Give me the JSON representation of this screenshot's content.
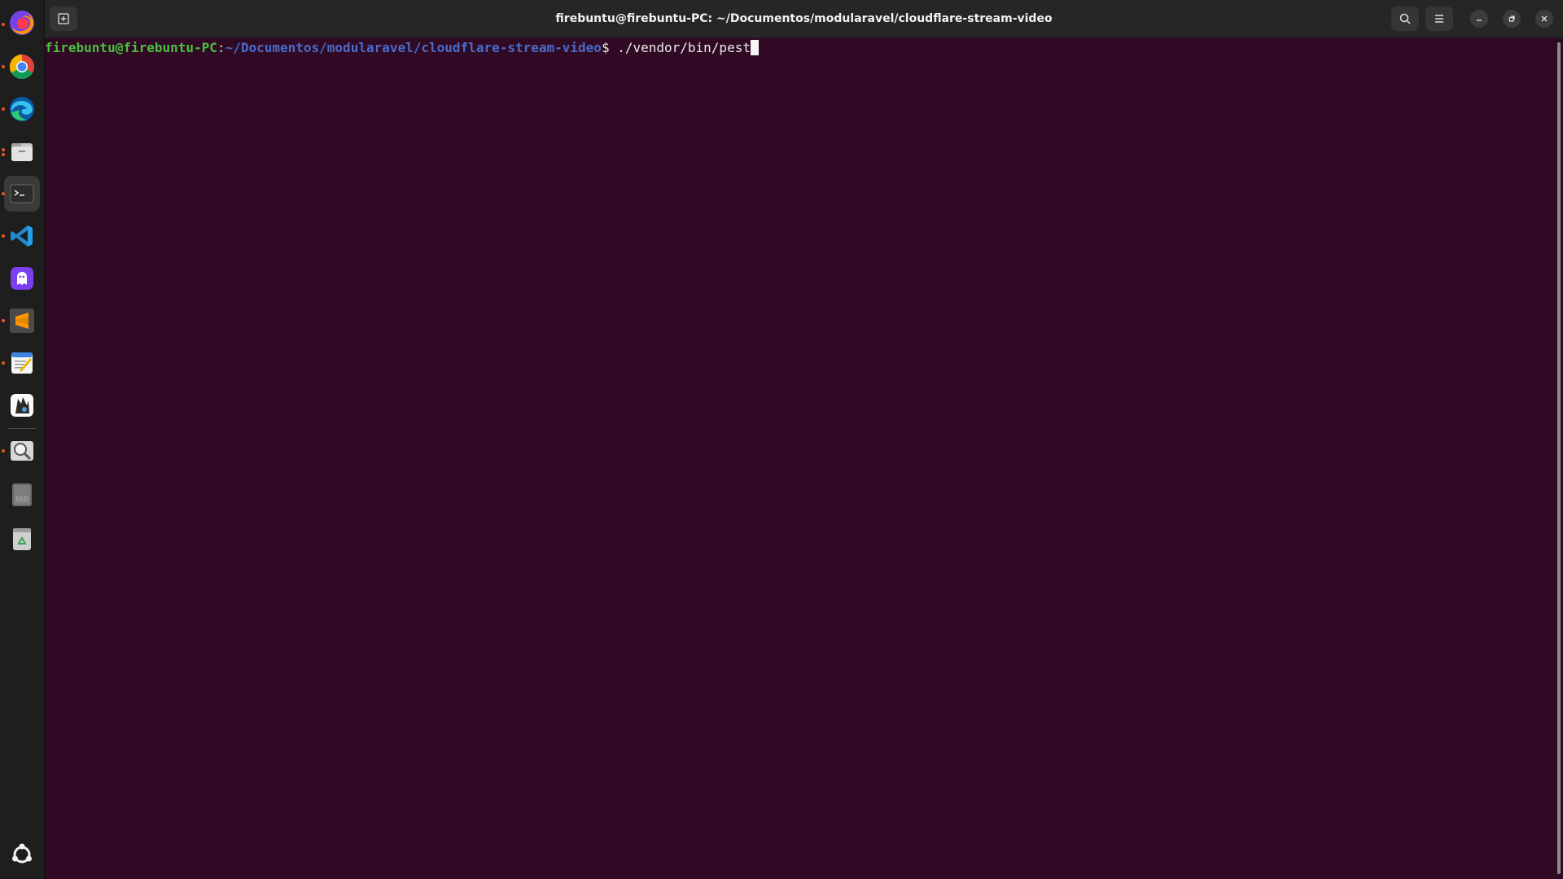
{
  "window": {
    "title": "firebuntu@firebuntu-PC: ~/Documentos/modularavel/cloudflare-stream-video"
  },
  "terminal": {
    "prompt_user_host": "firebuntu@firebuntu-PC",
    "prompt_colon": ":",
    "prompt_path": "~/Documentos/modularavel/cloudflare-stream-video",
    "prompt_symbol": "$ ",
    "command": "./vendor/bin/pest"
  },
  "dock": {
    "items": [
      {
        "icon": "firefox-icon",
        "running": true
      },
      {
        "icon": "chrome-icon",
        "running": true
      },
      {
        "icon": "edge-icon",
        "running": true
      },
      {
        "icon": "files-icon",
        "running": true
      },
      {
        "icon": "terminal-icon",
        "running": true,
        "active": true
      },
      {
        "icon": "vscode-icon",
        "running": true
      },
      {
        "icon": "ghost-app-icon",
        "running": false
      },
      {
        "icon": "sublime-text-icon",
        "running": true
      },
      {
        "icon": "text-editor-icon",
        "running": true
      },
      {
        "icon": "inkscape-icon",
        "running": false
      },
      {
        "icon": "image-viewer-icon",
        "running": true
      },
      {
        "icon": "ssd-drive-icon",
        "running": false
      },
      {
        "icon": "trash-icon",
        "running": false
      },
      {
        "icon": "show-apps-icon",
        "running": false
      }
    ],
    "ssd_label": "SSD"
  },
  "colors": {
    "terminal_bg": "#300a24",
    "prompt_user": "#4bbf3f",
    "prompt_path": "#4a6bc9",
    "accent": "#e95420"
  }
}
